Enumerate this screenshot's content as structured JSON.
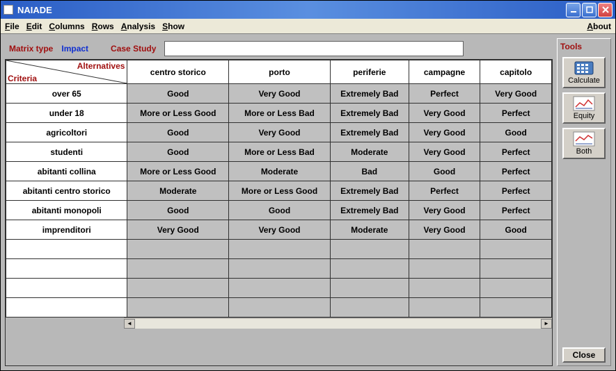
{
  "window": {
    "title": "NAIADE"
  },
  "menubar": {
    "items": [
      "File",
      "Edit",
      "Columns",
      "Rows",
      "Analysis",
      "Show"
    ],
    "right": "About"
  },
  "header": {
    "matrix_type_label": "Matrix type",
    "matrix_type_value": "Impact",
    "case_study_label": "Case Study",
    "case_study_value": ""
  },
  "grid": {
    "corner_alt": "Alternatives",
    "corner_crit": "Criteria",
    "columns": [
      "centro storico",
      "porto",
      "periferie",
      "campagne",
      "capitolo"
    ],
    "rows": [
      {
        "label": "over 65",
        "values": [
          "Good",
          "Very Good",
          "Extremely Bad",
          "Perfect",
          "Very Good"
        ]
      },
      {
        "label": "under 18",
        "values": [
          "More or Less Good",
          "More or Less Bad",
          "Extremely Bad",
          "Very Good",
          "Perfect"
        ]
      },
      {
        "label": "agricoltori",
        "values": [
          "Good",
          "Very Good",
          "Extremely Bad",
          "Very Good",
          "Good"
        ]
      },
      {
        "label": "studenti",
        "values": [
          "Good",
          "More or Less Bad",
          "Moderate",
          "Very Good",
          "Perfect"
        ]
      },
      {
        "label": "abitanti collina",
        "values": [
          "More or Less Good",
          "Moderate",
          "Bad",
          "Good",
          "Perfect"
        ]
      },
      {
        "label": "abitanti centro storico",
        "values": [
          "Moderate",
          "More or Less Good",
          "Extremely Bad",
          "Perfect",
          "Perfect"
        ]
      },
      {
        "label": "abitanti monopoli",
        "values": [
          "Good",
          "Good",
          "Extremely Bad",
          "Very Good",
          "Perfect"
        ]
      },
      {
        "label": "imprenditori",
        "values": [
          "Very Good",
          "Very Good",
          "Moderate",
          "Very Good",
          "Good"
        ]
      }
    ],
    "empty_rows": 4
  },
  "sidebar": {
    "title": "Tools",
    "tools": [
      {
        "label": "Calculate",
        "icon": "calc"
      },
      {
        "label": "Equity",
        "icon": "chart"
      },
      {
        "label": "Both",
        "icon": "chart"
      }
    ],
    "close": "Close"
  }
}
